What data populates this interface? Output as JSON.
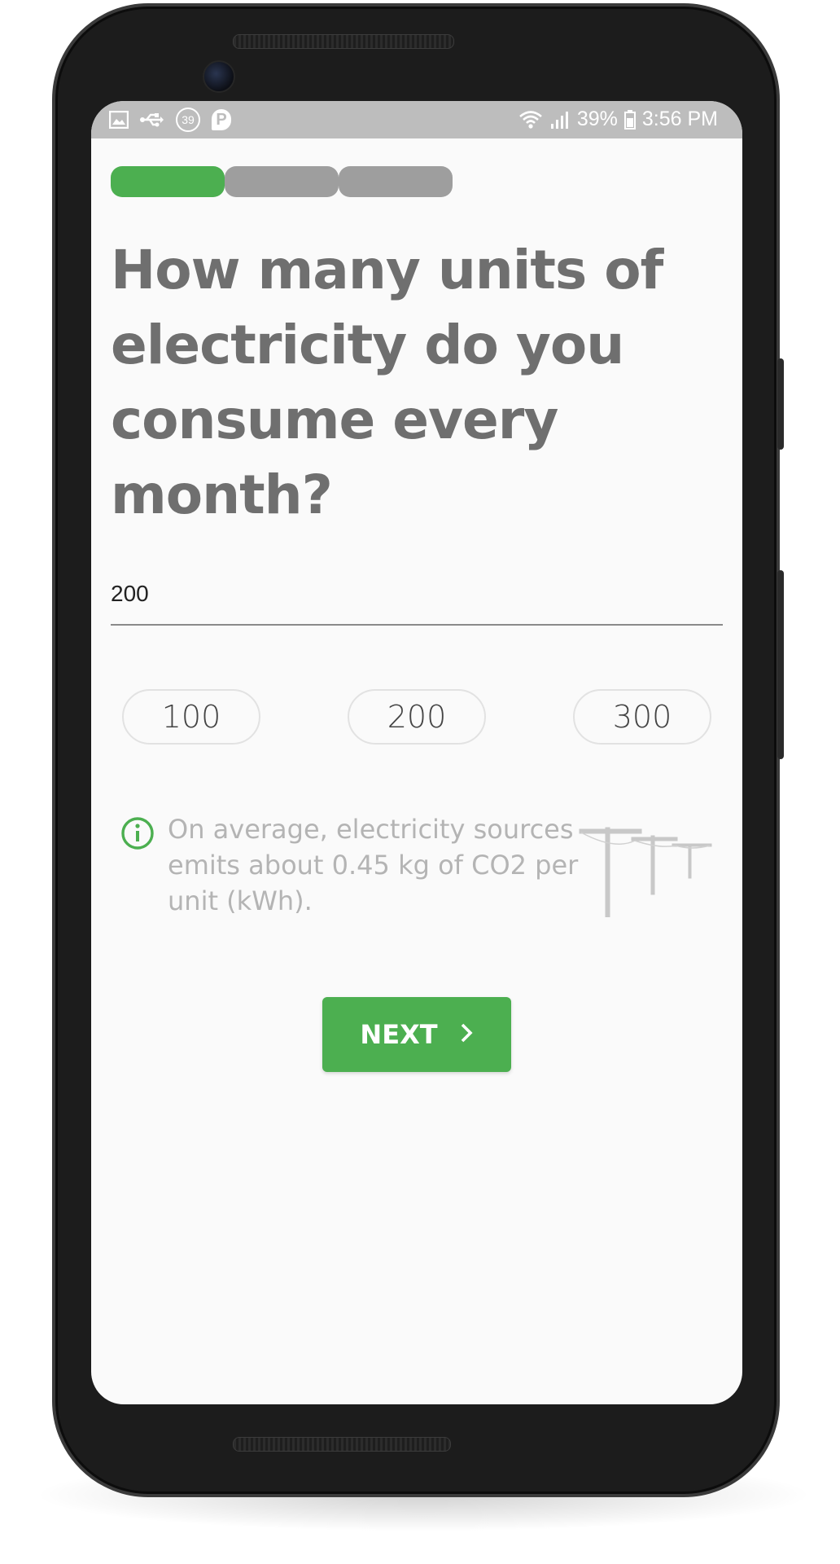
{
  "status_bar": {
    "left_icons": [
      "image-icon",
      "usb-icon",
      "notification-count-icon",
      "parking-icon"
    ],
    "notification_count": "39",
    "parking_letter": "P",
    "battery": "39%",
    "time": "3:56 PM"
  },
  "progress": {
    "steps": [
      {
        "state": "active",
        "color": "#4caf50"
      },
      {
        "state": "inactive",
        "color": "#9e9e9e"
      },
      {
        "state": "inactive",
        "color": "#9e9e9e"
      }
    ]
  },
  "question": {
    "text": "How many units of electricity do you consume every month?"
  },
  "units_input": {
    "value": "200"
  },
  "chips": [
    "100",
    "200",
    "300"
  ],
  "info": {
    "icon": "info-icon",
    "text": "On average, electricity sources emits about 0.45 kg of CO2 per unit (kWh).",
    "illustration": "power-poles-illustration"
  },
  "next_button": {
    "label": "NEXT",
    "icon": "chevron-right-icon",
    "color": "#4caf50"
  }
}
